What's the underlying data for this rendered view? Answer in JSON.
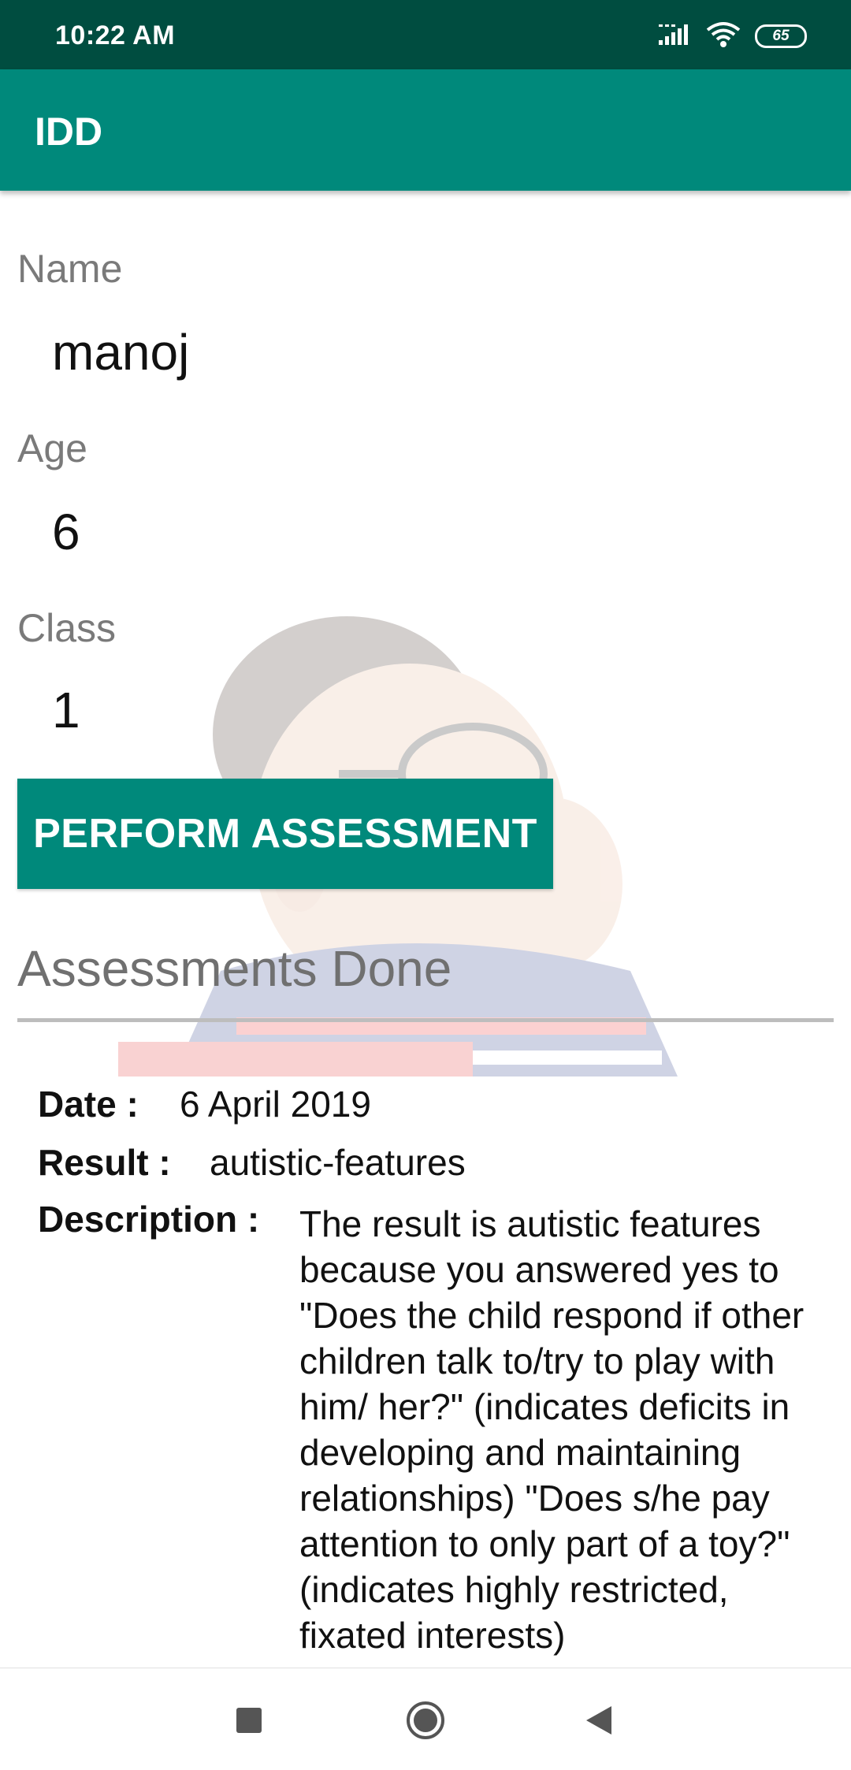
{
  "status_bar": {
    "time": "10:22 AM",
    "battery_level": "65",
    "icons": [
      "signal-icon",
      "wifi-icon",
      "battery-icon"
    ]
  },
  "app_bar": {
    "title": "IDD"
  },
  "profile": {
    "name_label": "Name",
    "name_value": "manoj",
    "age_label": "Age",
    "age_value": "6",
    "class_label": "Class",
    "class_value": "1"
  },
  "actions": {
    "perform_assessment_label": "PERFORM ASSESSMENT"
  },
  "assessments": {
    "section_title": "Assessments Done",
    "items": [
      {
        "date_label": "Date :",
        "date_value": "6 April 2019",
        "result_label": "Result :",
        "result_value": "autistic-features",
        "description_label": "Description :",
        "description_value": "The result is autistic features because you answered yes to \"Does the child respond if other children talk to/try to play with him/ her?\" (indicates deficits in developing and maintaining relationships) \"Does s/he pay attention to only part of a toy?\" (indicates highly restricted, fixated interests)"
      }
    ]
  },
  "navigation": {
    "buttons": [
      "recents-square-icon",
      "home-circle-icon",
      "back-triangle-icon"
    ]
  },
  "colors": {
    "status_bar": "#004d40",
    "primary": "#00897b"
  }
}
